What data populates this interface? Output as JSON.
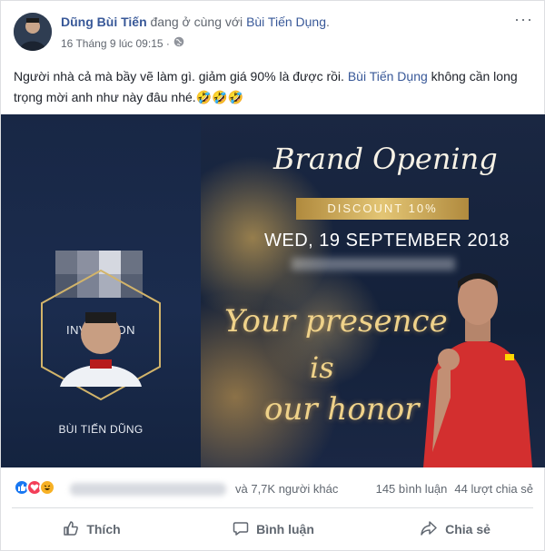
{
  "post": {
    "author": "Dũng Bùi Tiến",
    "with_text": " đang ở cùng với ",
    "tagged": "Bùi Tiến Dụng",
    "tagged_suffix": ".",
    "timestamp": "16 Tháng 9 lúc 09:15 ·",
    "privacy_icon": "globe-icon",
    "more_label": "···",
    "text_part1": "Người nhà cả mà bầy vẽ làm gì. giảm giá 90% là được rồi. ",
    "text_tag": "Bùi Tiến Dụng",
    "text_part2": " không cần long trọng mời anh như này đâu nhé.",
    "emojis": "🤣🤣🤣"
  },
  "image": {
    "invitation_label": "INVITATION",
    "guest_name": "BÙI TIẾN DŨNG",
    "brand_title": "Brand Opening",
    "discount": "DISCOUNT 10%",
    "date": "WED, 19  SEPTEMBER 2018",
    "script_line1": "Your presence",
    "script_line2": "is",
    "script_line3": "our honor"
  },
  "reactions": {
    "icons": [
      "like-icon",
      "love-icon",
      "haha-icon"
    ],
    "others": "và 7,7K người khác",
    "comments": "145 bình luận",
    "shares": "44 lượt chia sẻ"
  },
  "actions": {
    "like": "Thích",
    "comment": "Bình luận",
    "share": "Chia sẻ"
  },
  "colors": {
    "link": "#385898",
    "muted": "#606770",
    "like_blue": "#1877f2",
    "love_red": "#f33e58",
    "haha_yellow": "#f7b125"
  }
}
